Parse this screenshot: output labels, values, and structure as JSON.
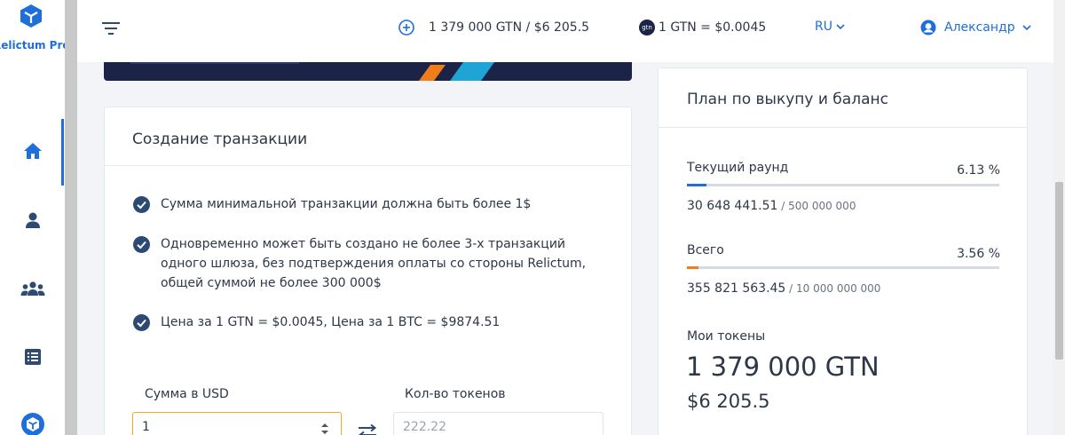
{
  "brand": {
    "name": "Relictum Pro"
  },
  "header": {
    "balance": "1 379 000 GTN",
    "balance_sep": " / ",
    "balance_usd": "$6 205.5",
    "rate_icon_text": "gtn",
    "rate": "1 GTN = $0.0045",
    "language": "RU",
    "user_name": "Александр"
  },
  "sidebar": {
    "items": [
      {
        "name": "home",
        "icon": "home-icon",
        "active": true
      },
      {
        "name": "profile",
        "icon": "user-icon",
        "active": false
      },
      {
        "name": "team",
        "icon": "users-icon",
        "active": false
      },
      {
        "name": "transactions",
        "icon": "list-icon",
        "active": false
      },
      {
        "name": "wallet",
        "icon": "cube-icon",
        "active": false
      }
    ]
  },
  "transaction": {
    "title": "Создание транзакции",
    "rules": [
      "Сумма минимальной транзакции должна быть более 1$",
      "Одновременно может быть создано не более 3-х транзакций одного шлюза, без подтверждения оплаты со стороны Relictum, общей суммой не более 300 000$",
      "Цена за 1 GTN = $0.0045, Цена за 1 BTC = $9874.51"
    ],
    "usd_label": "Сумма в USD",
    "usd_value": "1",
    "tokens_label": "Кол-во токенов",
    "tokens_value": "222.22"
  },
  "plan": {
    "title": "План по выкупу и баланс",
    "current_round": {
      "label": "Текущий раунд",
      "percent_text": "6.13 %",
      "percent": 6.13,
      "value": "30 648 441.51",
      "total": " / 500 000 000",
      "color": "#1e6fd9"
    },
    "overall": {
      "label": "Всего",
      "percent_text": "3.56 %",
      "percent": 3.56,
      "value": "355 821 563.45",
      "total": " / 10 000 000 000",
      "color": "#f07c1a"
    },
    "tokens_label": "Мои токены",
    "tokens_amount": "1 379 000 GTN",
    "tokens_usd": "$6 205.5"
  },
  "colors": {
    "accent": "#1e6fd9",
    "icon_dark": "#2d4a73",
    "focus": "#f3a81a"
  }
}
